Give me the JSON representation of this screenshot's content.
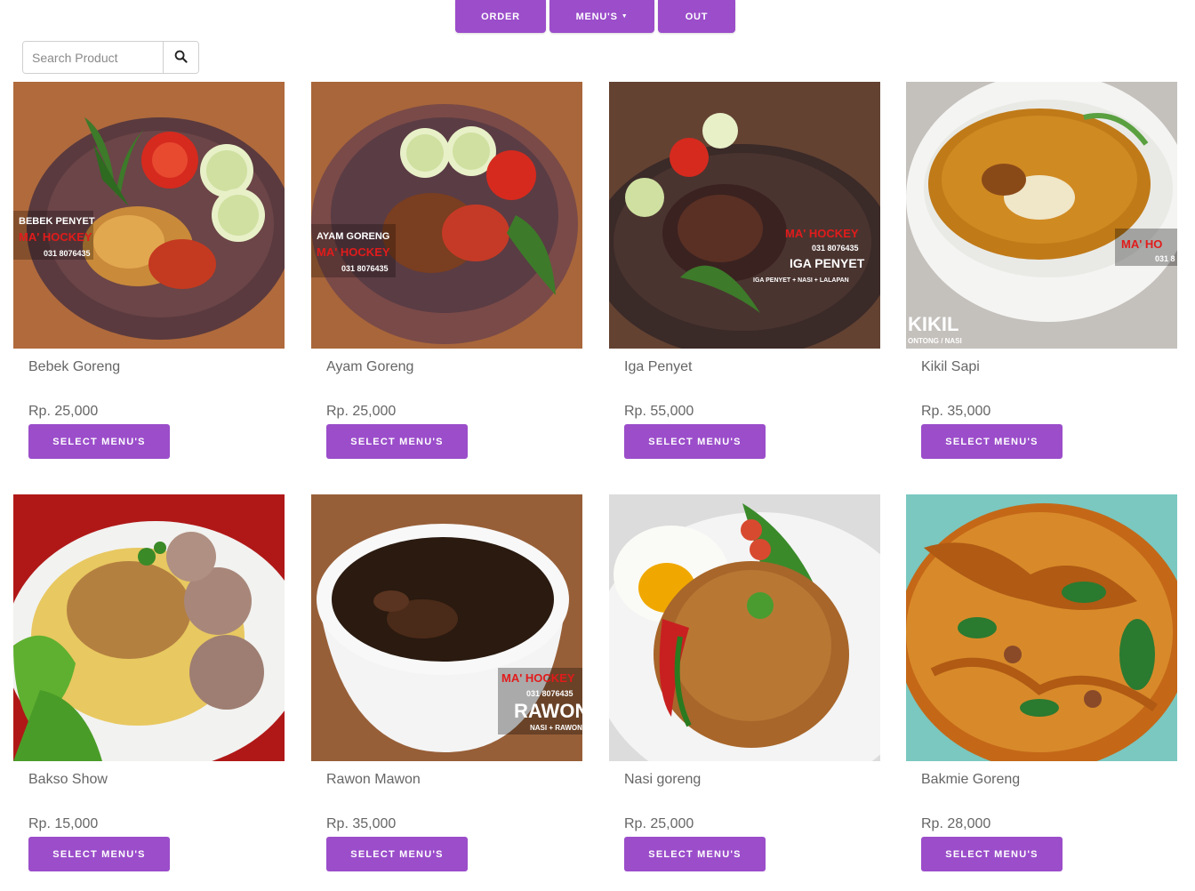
{
  "nav": {
    "order_label": "ORDER",
    "menus_label": "MENU'S",
    "out_label": "OUT"
  },
  "search": {
    "placeholder": "Search Product",
    "icon": "search-icon"
  },
  "accent_color": "#9b4dca",
  "products": [
    {
      "name": "Bebek Goreng",
      "price": "Rp. 25,000",
      "button": "SELECT MENU'S",
      "photo_text": [
        "BEBEK PENYET",
        "MA' HOCKEY",
        "031 8076435"
      ]
    },
    {
      "name": "Ayam Goreng",
      "price": "Rp. 25,000",
      "button": "SELECT MENU'S",
      "photo_text": [
        "AYAM GORENG",
        "MA' HOCKEY",
        "031 8076435"
      ]
    },
    {
      "name": "Iga Penyet",
      "price": "Rp. 55,000",
      "button": "SELECT MENU'S",
      "photo_text": [
        "MA' HOCKEY",
        "031 8076435",
        "IGA PENYET",
        "IGA PENYET + NASI + LALAPAN"
      ]
    },
    {
      "name": "Kikil Sapi",
      "price": "Rp. 35,000",
      "button": "SELECT MENU'S",
      "photo_text": [
        "MA' HO",
        "031 8",
        "KIKIL",
        "ONTONG / NASI"
      ]
    },
    {
      "name": "Bakso Show",
      "price": "Rp. 15,000",
      "button": "SELECT MENU'S",
      "photo_text": []
    },
    {
      "name": "Rawon Mawon",
      "price": "Rp. 35,000",
      "button": "SELECT MENU'S",
      "photo_text": [
        "MA' HOCKEY",
        "031 8076435",
        "RAWON",
        "NASI + RAWON"
      ]
    },
    {
      "name": "Nasi goreng",
      "price": "Rp. 25,000",
      "button": "SELECT MENU'S",
      "photo_text": []
    },
    {
      "name": "Bakmie Goreng",
      "price": "Rp. 28,000",
      "button": "SELECT MENU'S",
      "photo_text": []
    }
  ]
}
